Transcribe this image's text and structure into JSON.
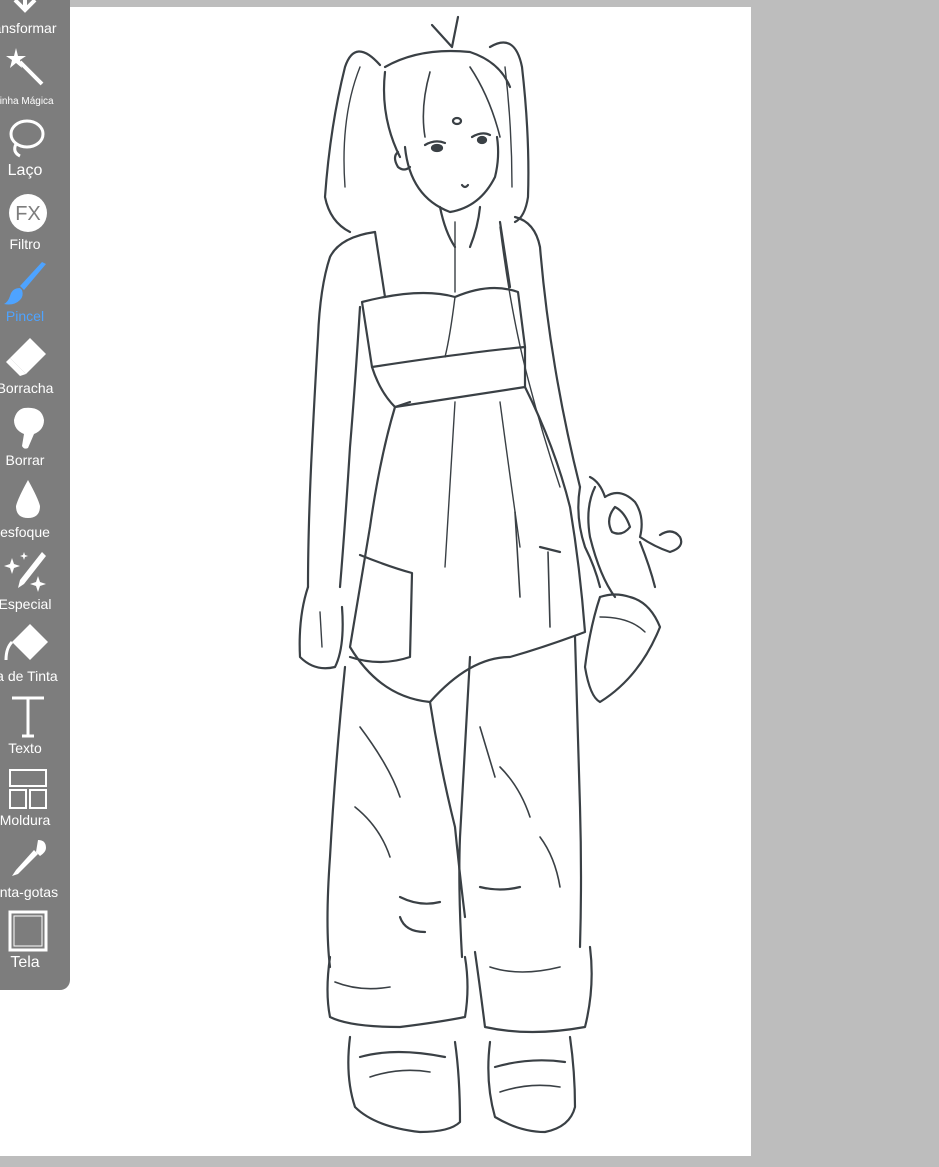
{
  "toolbar": {
    "tools": [
      {
        "label": "ansformar",
        "icon": "transform-move-icon",
        "active": false
      },
      {
        "label": "rinha Mágica",
        "icon": "magic-wand-icon",
        "active": false
      },
      {
        "label": "Laço",
        "icon": "lasso-icon",
        "active": false
      },
      {
        "label": "Filtro",
        "icon": "fx-filter-icon",
        "active": false
      },
      {
        "label": "Pincel",
        "icon": "brush-icon",
        "active": true
      },
      {
        "label": "Borracha",
        "icon": "eraser-icon",
        "active": false
      },
      {
        "label": "Borrar",
        "icon": "smudge-finger-icon",
        "active": false
      },
      {
        "label": "esfoque",
        "icon": "blur-drop-icon",
        "active": false
      },
      {
        "label": "Especial",
        "icon": "special-sparkle-pen-icon",
        "active": false
      },
      {
        "label": "ta de Tinta",
        "icon": "paint-bucket-icon",
        "active": false
      },
      {
        "label": "Texto",
        "icon": "text-t-icon",
        "active": false
      },
      {
        "label": "Moldura",
        "icon": "frame-divider-icon",
        "active": false
      },
      {
        "label": "onta-gotas",
        "icon": "eyedropper-icon",
        "active": false
      },
      {
        "label": "Tela",
        "icon": "canvas-square-icon",
        "active": false
      }
    ]
  },
  "colors": {
    "background": "#bdbdbd",
    "toolbar": "#7d7d7d",
    "active_tool": "#4ea3ff",
    "canvas": "#ffffff",
    "sketch_line": "#3a4045"
  }
}
